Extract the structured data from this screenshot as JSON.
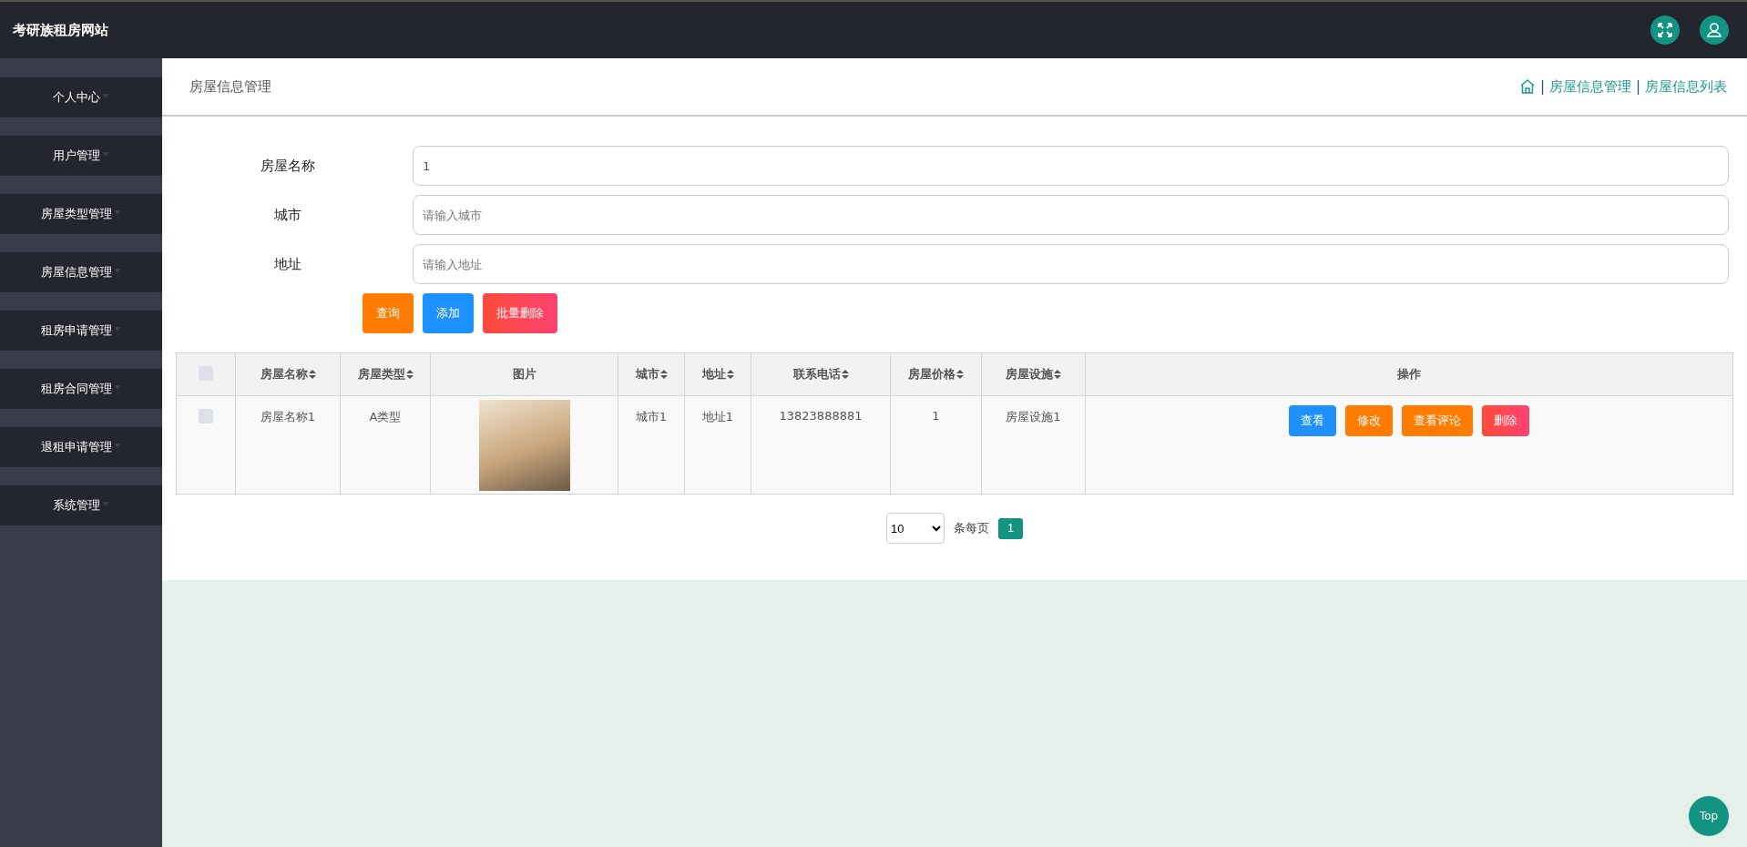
{
  "header": {
    "title": "考研族租房网站"
  },
  "sidebar": {
    "items": [
      {
        "label": "个人中心"
      },
      {
        "label": "用户管理"
      },
      {
        "label": "房屋类型管理"
      },
      {
        "label": "房屋信息管理"
      },
      {
        "label": "租房申请管理"
      },
      {
        "label": "租房合同管理"
      },
      {
        "label": "退租申请管理"
      },
      {
        "label": "系统管理"
      }
    ]
  },
  "page_title": "房屋信息管理",
  "breadcrumb": [
    {
      "separator": "|",
      "label": "房屋信息管理"
    },
    {
      "separator": "|",
      "label": "房屋信息列表"
    }
  ],
  "search_form": {
    "fields": [
      {
        "label": "房屋名称",
        "value": "1"
      },
      {
        "label": "城市",
        "placeholder": "请输入城市"
      },
      {
        "label": "地址",
        "placeholder": "请输入地址"
      }
    ],
    "buttons": [
      {
        "label": "查询",
        "kind": "search"
      },
      {
        "label": "添加",
        "kind": "add"
      },
      {
        "label": "批量删除",
        "kind": "delete"
      }
    ]
  },
  "table": {
    "select_all_checked": false,
    "columns": [
      {
        "label": "房屋名称",
        "sortable": true
      },
      {
        "label": "房屋类型",
        "sortable": true
      },
      {
        "label": "图片",
        "sortable": false
      },
      {
        "label": "城市",
        "sortable": true
      },
      {
        "label": "地址",
        "sortable": true
      },
      {
        "label": "联系电话",
        "sortable": true
      },
      {
        "label": "房屋价格",
        "sortable": true
      },
      {
        "label": "房屋设施",
        "sortable": true
      },
      {
        "label": "操作",
        "sortable": false
      }
    ],
    "rows": [
      {
        "checked": false,
        "name": "房屋名称1",
        "type": "A类型",
        "city": "城市1",
        "address": "地址1",
        "phone": "13823888881",
        "price": "1",
        "facilities": "房屋设施1",
        "actions": [
          {
            "label": "查看",
            "kind": "view"
          },
          {
            "label": "修改",
            "kind": "edit"
          },
          {
            "label": "查看评论",
            "kind": "edit"
          },
          {
            "label": "删除",
            "kind": "delete"
          }
        ]
      }
    ]
  },
  "pagination": {
    "page_size": "10",
    "page_size_label": "条每页",
    "pages": [
      {
        "label": "1",
        "selected": true
      }
    ]
  },
  "top_button": "Top"
}
